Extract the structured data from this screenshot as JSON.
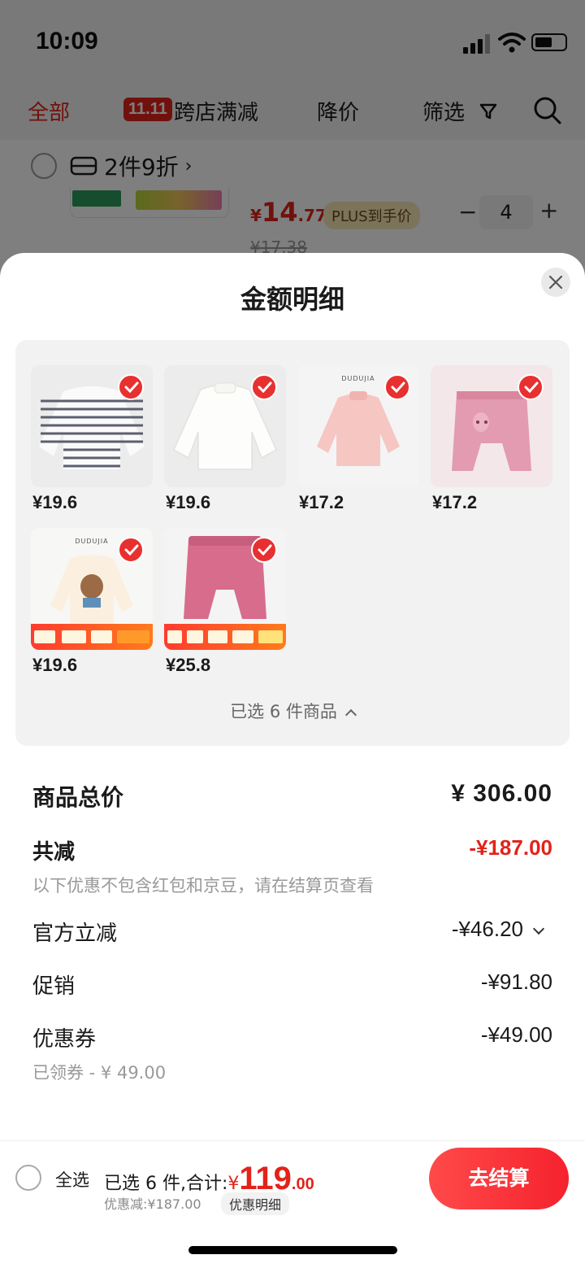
{
  "status_bar": {
    "time": "10:09"
  },
  "background": {
    "nav": {
      "all": "全部",
      "badge_1111": "11.11",
      "cross_store": "跨店满减",
      "price_drop": "降价",
      "filter": "筛选"
    },
    "promo": "2件9折",
    "item": {
      "currency": "¥",
      "price_int": "14",
      "price_dec": ".77",
      "plus_tag": "PLUS到手价",
      "qty": "4",
      "minus": "−",
      "plus": "+",
      "old_price": "¥17.38"
    }
  },
  "sheet": {
    "title": "金额明细",
    "goods": [
      {
        "price": "¥19.6",
        "style": "striped"
      },
      {
        "price": "¥19.6",
        "style": "white"
      },
      {
        "price": "¥17.2",
        "style": "pink-top",
        "brand": "DUDUJIA"
      },
      {
        "price": "¥17.2",
        "style": "pink-pants"
      },
      {
        "price": "¥19.6",
        "style": "bear-top",
        "brand": "DUDUJIA"
      },
      {
        "price": "¥25.8",
        "style": "rose-pants"
      }
    ],
    "selected_toggle": "已选 6 件商品",
    "rows": {
      "total": {
        "label": "商品总价",
        "value": "¥ 306.00"
      },
      "reduce": {
        "label": "共减",
        "value": "-¥187.00",
        "note": "以下优惠不包含红包和京豆，请在结算页查看"
      },
      "official": {
        "label": "官方立减",
        "value": "-¥46.20"
      },
      "promotion": {
        "label": "促销",
        "value": "-¥91.80"
      },
      "coupon": {
        "label": "优惠券",
        "value": "-¥49.00",
        "note": "已领券 - ¥ 49.00"
      }
    }
  },
  "bottom_bar": {
    "select_all": "全选",
    "summary_prefix": "已选 6 件,合计:",
    "currency": "¥",
    "total_int": "119",
    "total_dec": ".00",
    "discount": "优惠减:¥187.00",
    "detail_chip": "优惠明细",
    "checkout": "去结算"
  },
  "colors": {
    "accent": "#e2231a",
    "checkout": "#f5222d",
    "panel": "#f2f2f2"
  }
}
